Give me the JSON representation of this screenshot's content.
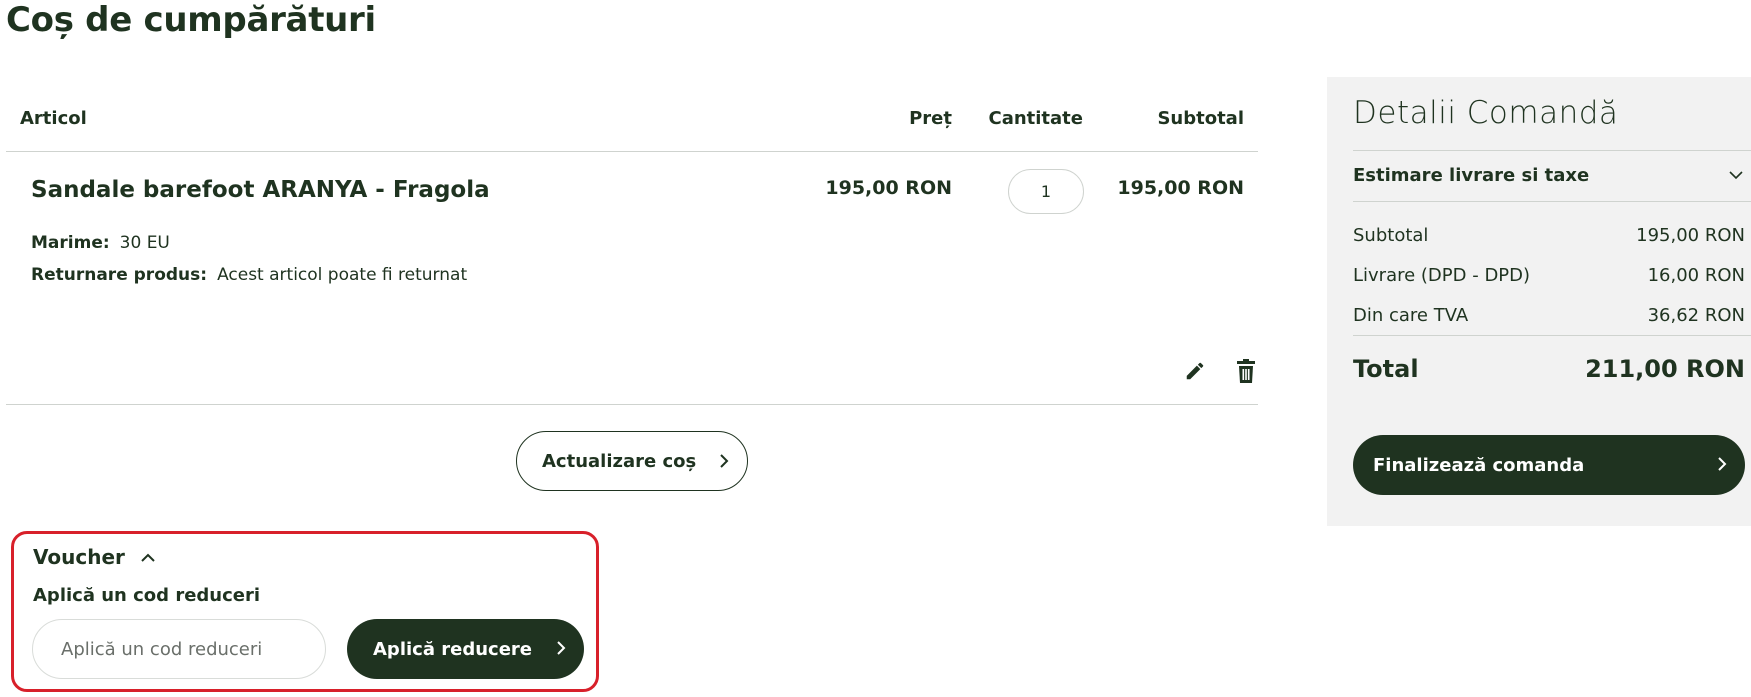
{
  "page": {
    "title": "Coș de cumpărături"
  },
  "cart": {
    "headers": {
      "article": "Articol",
      "price": "Preț",
      "quantity": "Cantitate",
      "subtotal": "Subtotal"
    },
    "item": {
      "name": "Sandale barefoot ARANYA - Fragola",
      "price": "195,00 RON",
      "quantity": "1",
      "subtotal": "195,00 RON",
      "size_label": "Marime:",
      "size_value": "30 EU",
      "return_label": "Returnare produs:",
      "return_value": "Acest articol poate fi returnat",
      "edit_icon": "pencil-icon",
      "delete_icon": "trash-icon"
    },
    "update_button": "Actualizare coș"
  },
  "voucher": {
    "title": "Voucher",
    "subtitle": "Aplică un cod reduceri",
    "placeholder": "Aplică un cod reduceri",
    "apply_button": "Aplică reducere"
  },
  "summary": {
    "title": "Detalii Comandă",
    "estimate_label": "Estimare livrare si taxe",
    "rows": [
      {
        "label": "Subtotal",
        "value": "195,00 RON"
      },
      {
        "label": "Livrare (DPD - DPD)",
        "value": "16,00 RON"
      },
      {
        "label": "Din care TVA",
        "value": "36,62 RON"
      }
    ],
    "total_label": "Total",
    "total_value": "211,00 RON",
    "checkout_button": "Finalizează comanda"
  },
  "colors": {
    "brand": "#1f3320",
    "highlight": "#d8202a",
    "summary_bg": "#f2f2f2"
  }
}
